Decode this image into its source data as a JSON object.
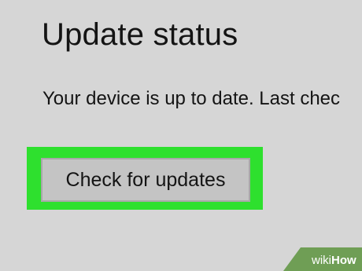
{
  "update": {
    "title": "Update status",
    "status_text": "Your device is up to date. Last chec",
    "check_button_label": "Check for updates"
  },
  "colors": {
    "background": "#d6d6d6",
    "highlight": "#2ee02e",
    "button_fill": "#c4c4c4",
    "watermark": "#6f9e55"
  },
  "watermark": {
    "brand": "wikiHow"
  }
}
